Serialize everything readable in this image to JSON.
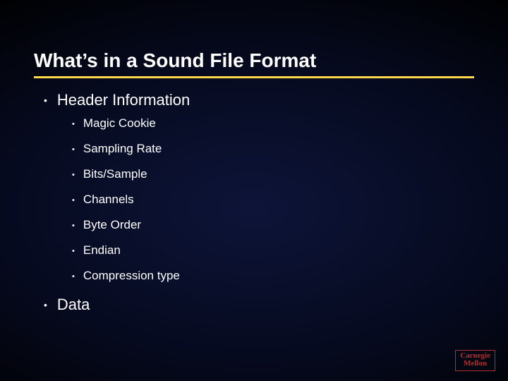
{
  "title": "What’s in a Sound File Format",
  "items": [
    {
      "label": "Header Information",
      "children": [
        {
          "label": "Magic Cookie"
        },
        {
          "label": "Sampling Rate"
        },
        {
          "label": "Bits/Sample"
        },
        {
          "label": "Channels"
        },
        {
          "label": "Byte Order"
        },
        {
          "label": "Endian"
        },
        {
          "label": "Compression type"
        }
      ]
    },
    {
      "label": "Data",
      "children": []
    }
  ],
  "logo": {
    "line1": "Carnegie",
    "line2": "Mellon"
  }
}
